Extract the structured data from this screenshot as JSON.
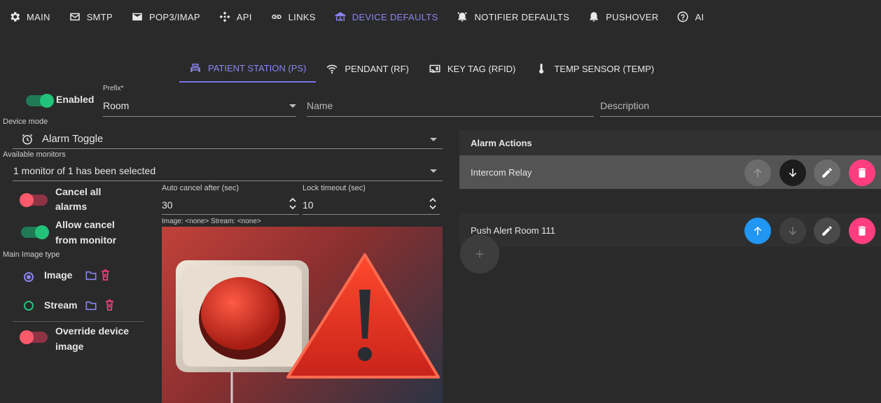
{
  "nav": [
    {
      "label": "MAIN",
      "icon": "gear-icon"
    },
    {
      "label": "SMTP",
      "icon": "envelope-outline-icon"
    },
    {
      "label": "POP3/IMAP",
      "icon": "envelope-icon"
    },
    {
      "label": "API",
      "icon": "api-icon"
    },
    {
      "label": "LINKS",
      "icon": "link-icon"
    },
    {
      "label": "DEVICE DEFAULTS",
      "icon": "device-defaults-icon",
      "active": true
    },
    {
      "label": "NOTIFIER DEFAULTS",
      "icon": "alarm-bell-icon"
    },
    {
      "label": "PUSHOVER",
      "icon": "bell-icon"
    },
    {
      "label": "AI",
      "icon": "help-circle-icon"
    }
  ],
  "tabs": [
    {
      "label": "PATIENT STATION (PS)",
      "icon": "patient-station-icon",
      "active": true
    },
    {
      "label": "PENDANT (RF)",
      "icon": "wifi-icon"
    },
    {
      "label": "KEY TAG (RFID)",
      "icon": "rfid-icon"
    },
    {
      "label": "TEMP SENSOR (TEMP)",
      "icon": "thermometer-icon"
    }
  ],
  "form": {
    "enabled_label": "Enabled",
    "prefix_label": "Prefix*",
    "prefix_value": "Room",
    "name_placeholder": "Name",
    "description_placeholder": "Description",
    "device_mode_label": "Device mode",
    "device_mode_value": "Alarm Toggle",
    "available_monitors_label": "Available monitors",
    "available_monitors_value": "1 monitor of 1 has been selected",
    "cancel_all_line1": "Cancel all",
    "cancel_all_line2": "alarms",
    "allow_cancel_line1": "Allow cancel",
    "allow_cancel_line2": "from monitor",
    "auto_cancel_label": "Auto cancel after (sec)",
    "auto_cancel_value": "30",
    "lock_timeout_label": "Lock timeout (sec)",
    "lock_timeout_value": "10",
    "image_stream_info": "Image: <none> Stream: <none>",
    "main_image_type_label": "Main Image type",
    "image_option": "Image",
    "stream_option": "Stream",
    "override_line1": "Override device",
    "override_line2": "image"
  },
  "alarm_actions": {
    "title": "Alarm Actions",
    "rows": [
      "Intercom Relay",
      "Push Alert Room 111"
    ]
  },
  "colors": {
    "accent": "#8b84f0",
    "toggle_on": "#23c27b",
    "toggle_off": "#ff5a6c",
    "delete": "#ff3d7f",
    "move_up_active": "#2196f3"
  }
}
